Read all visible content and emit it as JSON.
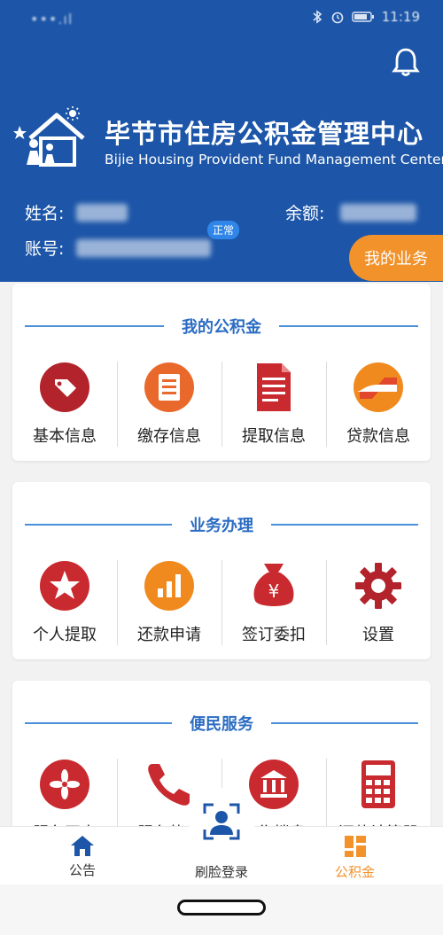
{
  "status_bar": {
    "left_text": "•••.ıl",
    "time": "11:19",
    "icons": [
      "signal-icon",
      "bluetooth-icon",
      "alarm-icon",
      "battery-icon"
    ]
  },
  "header": {
    "bell_icon": "bell-icon",
    "org_name_cn": "毕节市住房公积金管理中心",
    "org_name_en": "Bijie Housing Provident Fund Management Center",
    "name_label": "姓名:",
    "balance_label": "余额:",
    "account_label": "账号:",
    "status_tag": "正常",
    "my_business_button": "我的业务",
    "colors": {
      "primary": "#1d56a8",
      "accent": "#f2922b"
    }
  },
  "sections": [
    {
      "title": "我的公积金",
      "items": [
        {
          "label": "基本信息",
          "icon": "tag-icon"
        },
        {
          "label": "缴存信息",
          "icon": "list-icon"
        },
        {
          "label": "提取信息",
          "icon": "document-icon"
        },
        {
          "label": "贷款信息",
          "icon": "loan-icon"
        }
      ]
    },
    {
      "title": "业务办理",
      "items": [
        {
          "label": "个人提取",
          "icon": "star-icon"
        },
        {
          "label": "还款申请",
          "icon": "bar-chart-icon"
        },
        {
          "label": "签订委扣",
          "icon": "money-bag-icon"
        },
        {
          "label": "设置",
          "icon": "gear-icon"
        }
      ]
    },
    {
      "title": "便民服务",
      "items": [
        {
          "label": "服务网点",
          "icon": "flower-icon"
        },
        {
          "label": "服务热线",
          "icon": "phone-icon"
        },
        {
          "label": "在售楼盘",
          "icon": "building-icon"
        },
        {
          "label": "还款计算器",
          "icon": "calculator-icon"
        }
      ]
    }
  ],
  "bottom_nav": {
    "items": [
      {
        "label": "公告",
        "icon": "home-icon"
      },
      {
        "label": "刷脸登录",
        "icon": "face-scan-icon"
      },
      {
        "label": "公积金",
        "icon": "grid-icon",
        "active": true
      }
    ]
  }
}
